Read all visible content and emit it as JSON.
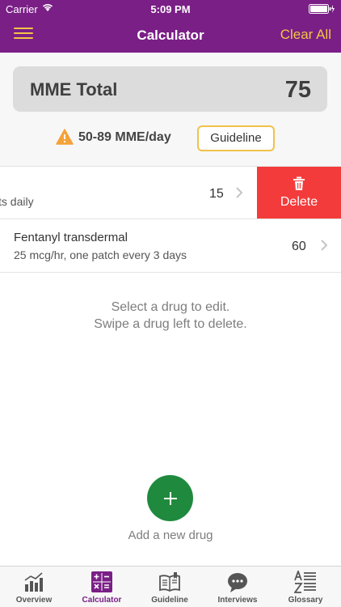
{
  "status_bar": {
    "carrier": "Carrier",
    "time": "5:09 PM"
  },
  "nav": {
    "title": "Calculator",
    "clear_label": "Clear All",
    "menu_icon": "hamburger-icon"
  },
  "summary": {
    "mme_label": "MME Total",
    "mme_value": "75",
    "warning_text": "50-89 MME/day",
    "guideline_button": "Guideline"
  },
  "drugs": [
    {
      "name": "",
      "detail": "ts daily",
      "mme": "15",
      "swiped": true,
      "delete_label": "Delete"
    },
    {
      "name": "Fentanyl transdermal",
      "detail": "25 mcg/hr, one patch every 3 days",
      "mme": "60",
      "swiped": false
    }
  ],
  "hint": {
    "line1": "Select a drug to edit.",
    "line2": "Swipe a drug left to delete."
  },
  "add": {
    "label": "Add a new drug"
  },
  "tabs": [
    {
      "label": "Overview",
      "icon": "bar-chart-icon",
      "active": false
    },
    {
      "label": "Calculator",
      "icon": "calculator-icon",
      "active": true
    },
    {
      "label": "Guideline",
      "icon": "book-icon",
      "active": false
    },
    {
      "label": "Interviews",
      "icon": "chat-bubble-icon",
      "active": false
    },
    {
      "label": "Glossary",
      "icon": "a-z-list-icon",
      "active": false
    }
  ],
  "colors": {
    "brand_purple": "#7a1f86",
    "accent_yellow": "#f5c445",
    "delete_red": "#f43b3b",
    "add_green": "#1f8a3e",
    "warning_orange": "#f4a23a"
  }
}
